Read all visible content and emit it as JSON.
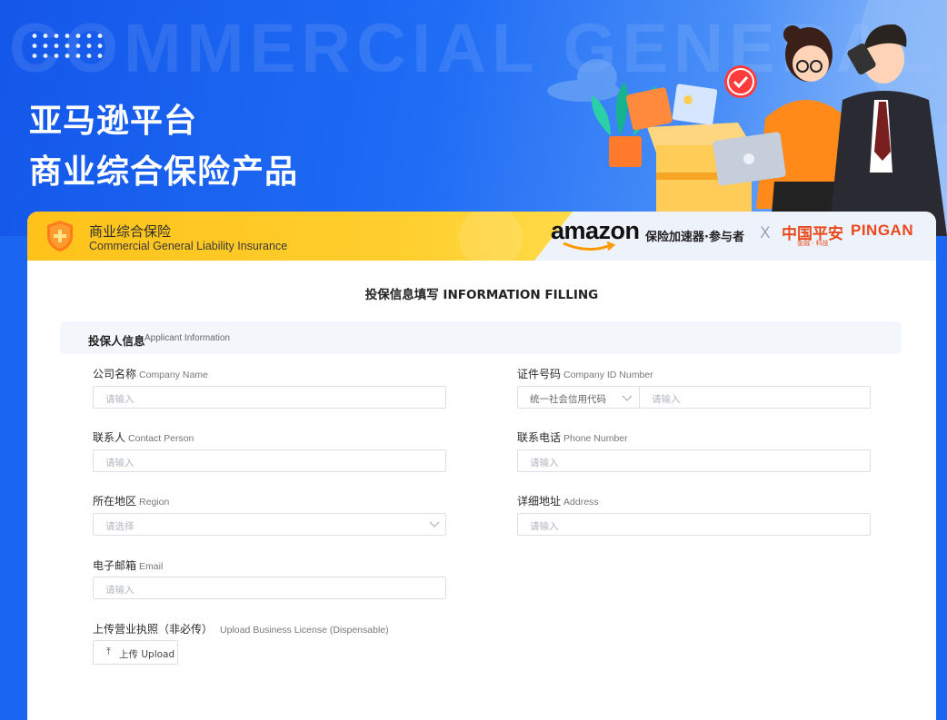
{
  "hero": {
    "watermark": "COMMERCIAL GENERAL LIABILITY",
    "title_line1": "亚马逊平台",
    "title_line2": "商业综合保险产品"
  },
  "banner": {
    "title_cn": "商业综合保险",
    "title_en": "Commercial General Liability Insurance",
    "amazon_logo": "amazon",
    "accelerator": "保险加速器·参与者",
    "x_sep": "X",
    "pingan_cn": "中国平安",
    "pingan_en": "PINGAN",
    "pingan_sub": "金融 · 科技"
  },
  "form": {
    "title": "投保信息填写 INFORMATION FILLING",
    "section_cn": "投保人信息",
    "section_en": "Applicant Information",
    "company_name": {
      "label_cn": "公司名称",
      "label_en": "Company Name",
      "placeholder": "请输入"
    },
    "company_id": {
      "label_cn": "证件号码",
      "label_en": "Company ID Number",
      "type_value": "统一社会信用代码",
      "placeholder": "请输入"
    },
    "contact": {
      "label_cn": "联系人",
      "label_en": "Contact Person",
      "placeholder": "请输入"
    },
    "phone": {
      "label_cn": "联系电话",
      "label_en": "Phone Number",
      "placeholder": "请输入"
    },
    "region": {
      "label_cn": "所在地区",
      "label_en": "Region",
      "placeholder": "请选择"
    },
    "address": {
      "label_cn": "详细地址",
      "label_en": "Address",
      "placeholder": "请输入"
    },
    "email": {
      "label_cn": "电子邮箱",
      "label_en": "Email",
      "placeholder": "请输入"
    },
    "upload": {
      "label_cn": "上传营业执照（非必传）",
      "label_en": "Upload Business License (Dispensable)",
      "button": "上传 Upload",
      "icon": "upload-icon"
    }
  },
  "colors": {
    "hero_blue": "#1a66f3",
    "banner_yellow": "#ffc21a",
    "pingan_orange": "#e8491d"
  }
}
